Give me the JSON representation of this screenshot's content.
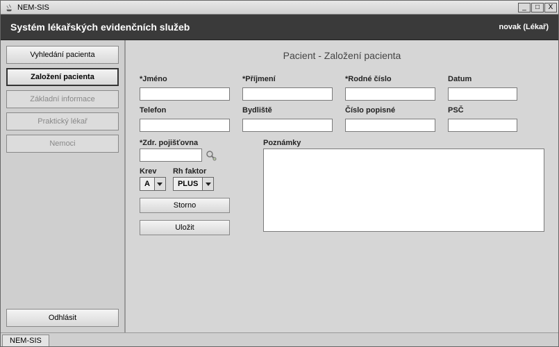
{
  "window": {
    "title": "NEM-SIS"
  },
  "header": {
    "subtitle": "Systém lékařských evidenčních služeb",
    "user": "novak  (Lékař)"
  },
  "sidebar": {
    "items": [
      {
        "label": "Vyhledání pacienta",
        "state": "normal"
      },
      {
        "label": "Založení pacienta",
        "state": "active"
      },
      {
        "label": "Základní informace",
        "state": "disabled"
      },
      {
        "label": "Praktický lékař",
        "state": "disabled"
      },
      {
        "label": "Nemoci",
        "state": "disabled"
      }
    ],
    "logout_label": "Odhlásit"
  },
  "page": {
    "title": "Pacient - Založení pacienta"
  },
  "form": {
    "labels": {
      "jmeno": "*Jméno",
      "prijmeni": "*Příjmení",
      "rodne_cislo": "*Rodné číslo",
      "datum": "Datum",
      "telefon": "Telefon",
      "bydliste": "Bydliště",
      "cislo_popisne": "Číslo popisné",
      "psc": "PSČ",
      "pojistovna": "*Zdr. pojišťovna",
      "poznamky": "Poznámky",
      "krev": "Krev",
      "rh": "Rh faktor"
    },
    "values": {
      "jmeno": "",
      "prijmeni": "",
      "rodne_cislo": "",
      "datum": "",
      "telefon": "",
      "bydliste": "",
      "cislo_popisne": "",
      "psc": "",
      "pojistovna": "",
      "poznamky": "",
      "krev": "A",
      "rh": "PLUS"
    },
    "buttons": {
      "storno": "Storno",
      "ulozit": "Uložit"
    }
  },
  "tabs": {
    "bottom": "NEM-SIS"
  }
}
